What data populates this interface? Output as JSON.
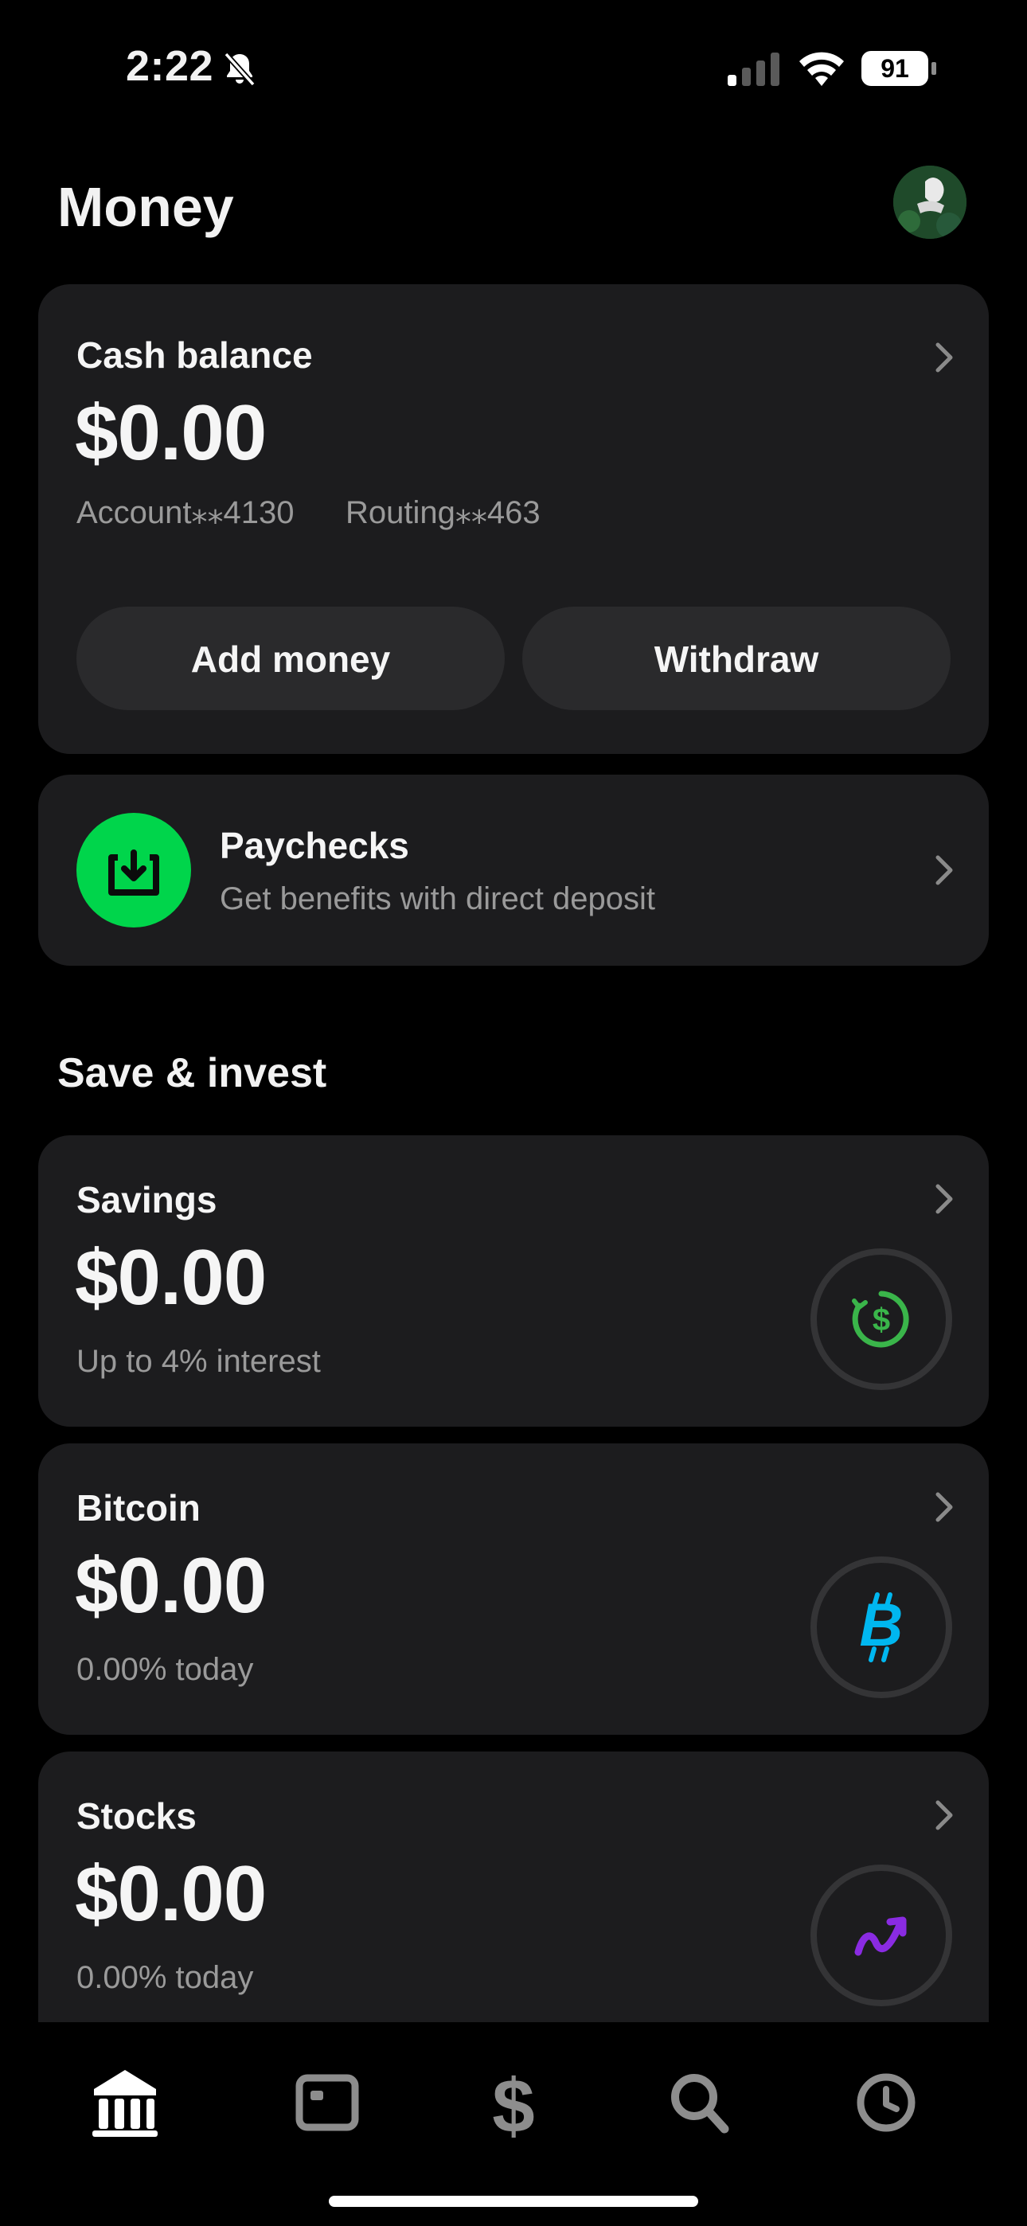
{
  "status_bar": {
    "time": "2:22",
    "battery": "91"
  },
  "header": {
    "title": "Money"
  },
  "cash_card": {
    "title": "Cash balance",
    "amount": "$0.00",
    "account": "Account⁎⁎4130",
    "routing": "Routing⁎⁎463",
    "add_money_label": "Add money",
    "withdraw_label": "Withdraw"
  },
  "paychecks": {
    "title": "Paychecks",
    "subtitle": "Get benefits with direct deposit"
  },
  "section": {
    "label": "Save & invest"
  },
  "savings": {
    "title": "Savings",
    "amount": "$0.00",
    "subtitle": "Up to 4% interest"
  },
  "bitcoin": {
    "title": "Bitcoin",
    "amount": "$0.00",
    "subtitle": "0.00% today"
  },
  "stocks": {
    "title": "Stocks",
    "amount": "$0.00",
    "subtitle": "0.00% today"
  },
  "tabs": [
    "home-icon",
    "card-icon",
    "dollar-icon",
    "search-icon",
    "activity-clock-icon"
  ],
  "colors": {
    "accent_green": "#00d54b",
    "bitcoin_blue": "#00b7f0",
    "stocks_purple": "#8a2be2",
    "savings_green": "#3ab54a"
  }
}
